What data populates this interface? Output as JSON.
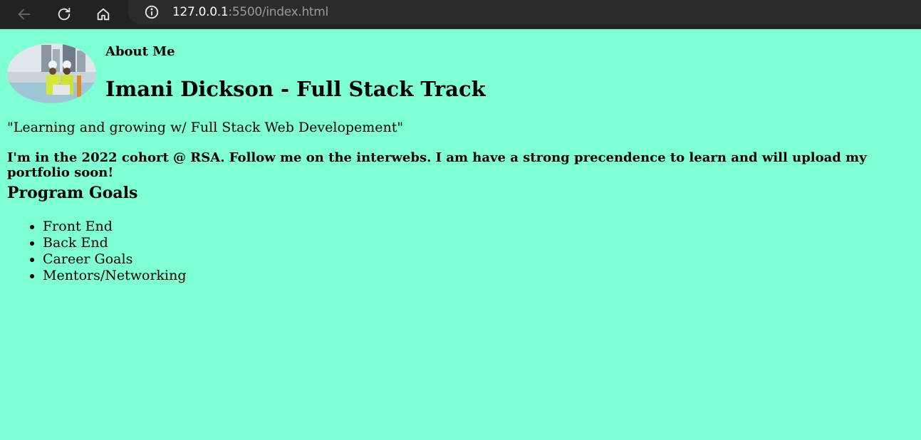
{
  "browser": {
    "url_host": "127.0.0.1",
    "url_rest": ":5500/index.html",
    "back_icon": "arrow-left-icon",
    "reload_icon": "reload-icon",
    "home_icon": "home-icon",
    "info_icon": "info-icon"
  },
  "page": {
    "background_color": "#7fffd4",
    "about_label": "About Me",
    "title": "Imani Dickson - Full Stack Track",
    "tagline": "\"Learning and growing w/ Full Stack Web Developement\"",
    "bio": "I'm in the 2022 cohort @ RSA. Follow me on the interwebs. I am have a strong precendence to learn and will upload my portfolio soon!",
    "goals_heading": "Program Goals",
    "goals": [
      "Front End",
      "Back End",
      "Career Goals",
      "Mentors/Networking"
    ]
  }
}
